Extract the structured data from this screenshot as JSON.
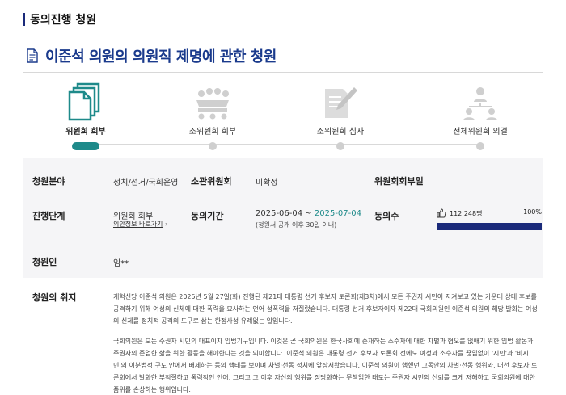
{
  "section": {
    "title": "동의진행 청원"
  },
  "petition": {
    "title": "이준석 의원의 의원직 제명에 관한 청원"
  },
  "steps": [
    {
      "label": "위원회 회부",
      "icon": "documents-icon",
      "active": true
    },
    {
      "label": "소위원회 회부",
      "icon": "meeting-table-icon",
      "active": false
    },
    {
      "label": "소위원회 심사",
      "icon": "review-pen-icon",
      "active": false
    },
    {
      "label": "전체위원회 의결",
      "icon": "org-chart-icon",
      "active": false
    }
  ],
  "info": {
    "field_label": "청원분야",
    "field_value": "정치/선거/국회운영",
    "subcommittee_label": "소관위원회",
    "subcommittee_value": "미확정",
    "vote_label": "위원회회부일",
    "vote_value": "",
    "stage_label": "진행단계",
    "stage_value": "위원회 회부",
    "stage_link": "의안정보 바로가기",
    "period_label": "동의기간",
    "period_start": "2025-06-04",
    "period_sep": " ~ ",
    "period_end": "2025-07-04",
    "period_note": "(청원서 공개 이후 30일 이내)",
    "agree_label": "동의수",
    "agree_count": "112,248명",
    "agree_percent": "100%",
    "agree_fraction": 1.0,
    "petitioner_label": "청원인",
    "petitioner_value": "임**"
  },
  "purpose": {
    "label": "청원의 취지",
    "paragraphs": [
      "개혁신당 이준석 의원은 2025년 5월 27일(화) 진행된 제21대 대통령 선거 후보자 토론회(제3차)에서 모든 주권자 시민이 지켜보고 있는 가운데 상대 후보를 공격하기 위해 여성의 신체에 대한 폭력을 묘사하는 언어 성폭력을 저질렀습니다. 대통령 선거 후보자이자 제22대 국회의원인 이준석 의원의 해당 발화는 여성의 신체를 정치적 공격의 도구로 삼는 한정사성 유례없는 일입니다.",
      "국회의원은 모든 주권자 시민의 대표이자 입법기구입니다. 이것은 곧 국회의원은 한국사회에 존재하는 소수자에 대한 차별과 혐오를 없애기 위한 입법 활동과 주권자의 존엄한 삶을 위한 활동을 해야한다는 것을 의미합니다. 이준석 의원은 대통령 선거 후보자 토론회 전에도 여성과 소수자를 끊임없이 '시민'과 '비시민'의 이분법적 구도 안에서 배제하는 등의 행태를 보이며 차별·선동 정치에 앞장서왔습니다. 이준석 의원이 행했던 그동안의 차별·선동 행위와, 대선 후보자 토론회에서 발화한 부적절하고 폭력적인 언어, 그리고 그 이후 자신의 행위를 정당화하는 무책임한 태도는 주권자 시민의 신뢰를 크게 저해하고 국회의원에 대한 품위를 손상하는 행위입니다."
    ]
  },
  "colors": {
    "accent": "#1e8a8a",
    "navy": "#1a2a7a",
    "title_blue": "#1a3a8c",
    "period_end": "#1e8a8a"
  }
}
